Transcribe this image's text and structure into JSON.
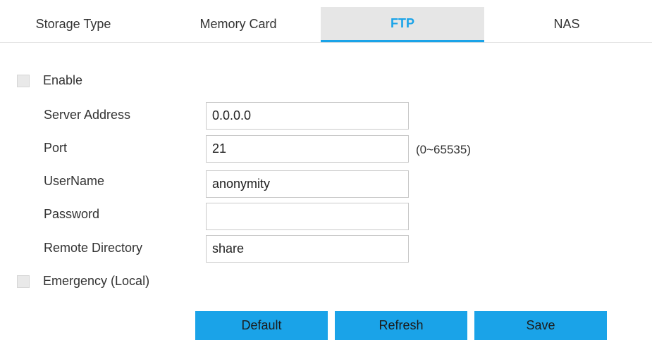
{
  "tabs": [
    {
      "label": "Storage Type",
      "active": false
    },
    {
      "label": "Memory Card",
      "active": false
    },
    {
      "label": "FTP",
      "active": true
    },
    {
      "label": "NAS",
      "active": false
    }
  ],
  "enable": {
    "label": "Enable",
    "checked": false
  },
  "form": {
    "server_address": {
      "label": "Server Address",
      "value": "0.0.0.0"
    },
    "port": {
      "label": "Port",
      "value": "21",
      "hint": "(0~65535)"
    },
    "username": {
      "label": "UserName",
      "value": "anonymity"
    },
    "password": {
      "label": "Password",
      "value": ""
    },
    "remote_directory": {
      "label": "Remote Directory",
      "value": "share"
    }
  },
  "emergency": {
    "label": "Emergency (Local)",
    "checked": false
  },
  "buttons": {
    "default_label": "Default",
    "refresh_label": "Refresh",
    "save_label": "Save"
  },
  "colors": {
    "accent": "#1aa3e8",
    "active_tab_bg": "#e6e6e6",
    "checkbox_bg": "#e9e9e9"
  }
}
